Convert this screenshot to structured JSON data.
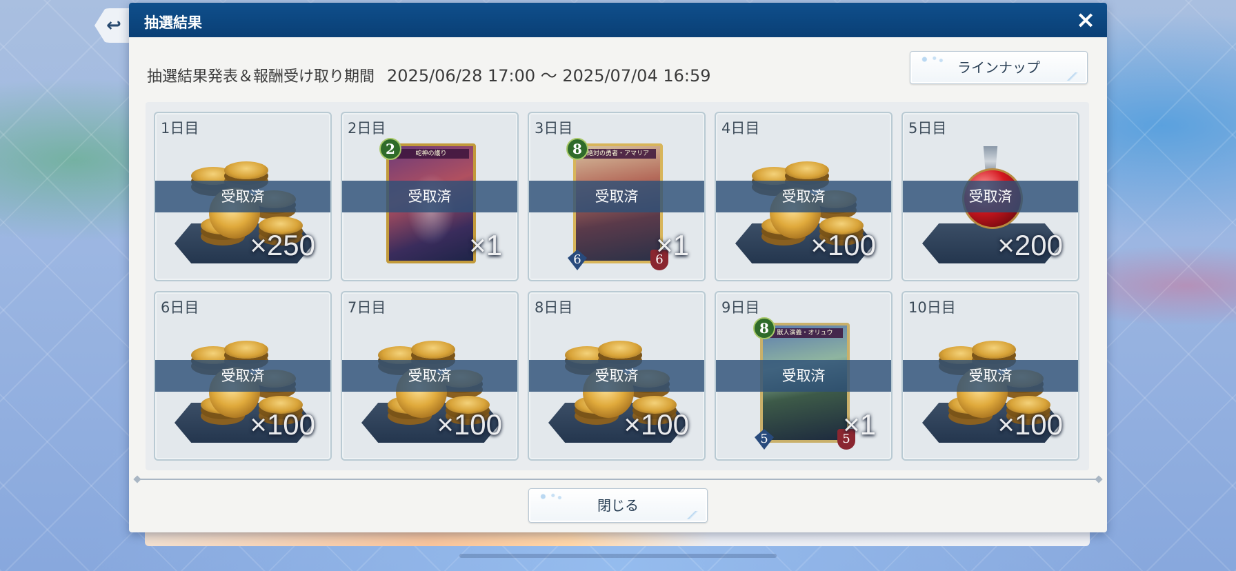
{
  "dialog": {
    "title": "抽選結果",
    "close_icon": "×",
    "period_label": "抽選結果発表＆報酬受け取り期間",
    "period_dates": "2025/06/28 17:00 ～ 2025/07/04 16:59",
    "lineup_label": "ラインナップ",
    "close_label": "閉じる"
  },
  "back_icon": "↩",
  "days": [
    {
      "label": "1日目",
      "item": "coins",
      "qty": "×250",
      "status": "受取済"
    },
    {
      "label": "2日目",
      "item": "card",
      "card_name": "蛇神の護り",
      "cost": "2",
      "qty": "×1",
      "status": "受取済"
    },
    {
      "label": "3日目",
      "item": "card",
      "card_name": "絶対の勇者・アマリア",
      "cost": "8",
      "atk": "6",
      "def": "6",
      "qty": "×1",
      "status": "受取済"
    },
    {
      "label": "4日目",
      "item": "coins",
      "qty": "×100",
      "status": "受取済"
    },
    {
      "label": "5日目",
      "item": "potion",
      "qty": "×200",
      "status": "受取済"
    },
    {
      "label": "6日目",
      "item": "coins",
      "qty": "×100",
      "status": "受取済"
    },
    {
      "label": "7日目",
      "item": "coins",
      "qty": "×100",
      "status": "受取済"
    },
    {
      "label": "8日目",
      "item": "coins",
      "qty": "×100",
      "status": "受取済"
    },
    {
      "label": "9日目",
      "item": "card",
      "card_name": "獣人演義・オリュウ",
      "cost": "8",
      "atk": "5",
      "def": "5",
      "qty": "×1",
      "status": "受取済"
    },
    {
      "label": "10日目",
      "item": "coins",
      "qty": "×100",
      "status": "受取済"
    }
  ]
}
